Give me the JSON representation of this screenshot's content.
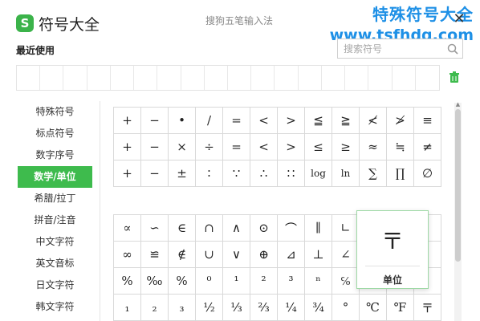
{
  "window": {
    "logo_letter": "S",
    "title": "符号大全",
    "subtitle": "搜狗五笔输入法",
    "close_symbol": "✕"
  },
  "watermark": {
    "line1": "特殊符号大全",
    "line2": "www.tsfhdq.com"
  },
  "recent": {
    "label": "最近使用",
    "search_placeholder": "搜索符号",
    "search_value": ""
  },
  "sidebar": {
    "items": [
      {
        "label": "特殊符号",
        "active": false
      },
      {
        "label": "标点符号",
        "active": false
      },
      {
        "label": "数字序号",
        "active": false
      },
      {
        "label": "数学/单位",
        "active": true
      },
      {
        "label": "希腊/拉丁",
        "active": false
      },
      {
        "label": "拼音/注音",
        "active": false
      },
      {
        "label": "中文字符",
        "active": false
      },
      {
        "label": "英文音标",
        "active": false
      },
      {
        "label": "日文字符",
        "active": false
      },
      {
        "label": "韩文字符",
        "active": false
      }
    ]
  },
  "grid1": [
    "+",
    "−",
    "•",
    "/",
    "=",
    "<",
    ">",
    "≦",
    "≧",
    "≮",
    "≯",
    "≡",
    "+",
    "−",
    "×",
    "÷",
    "=",
    "<",
    ">",
    "≤",
    "≥",
    "≈",
    "≒",
    "≠",
    "+",
    "−",
    "±",
    "∶",
    "∵",
    "∴",
    "∷",
    "log",
    "ln",
    "∑",
    "∏",
    "∅"
  ],
  "grid2": [
    "∝",
    "∽",
    "∈",
    "∩",
    "∧",
    "⊙",
    "⌒",
    "∥",
    "∟",
    "",
    "",
    "",
    "∞",
    "≌",
    "∉",
    "∪",
    "∨",
    "⊕",
    "⊿",
    "⊥",
    "∠",
    "",
    "",
    "",
    "%",
    "‰",
    "%",
    "⁰",
    "¹",
    "²",
    "³",
    "ⁿ",
    "℅",
    "",
    "",
    "",
    "₁",
    "₂",
    "₃",
    "½",
    "⅓",
    "⅔",
    "¼",
    "¾",
    "°",
    "℃",
    "℉",
    "〒"
  ],
  "preview": {
    "symbol": "〒",
    "label": "单位"
  },
  "colors": {
    "accent": "#3ebb4d",
    "watermark": "#1e90e6"
  }
}
